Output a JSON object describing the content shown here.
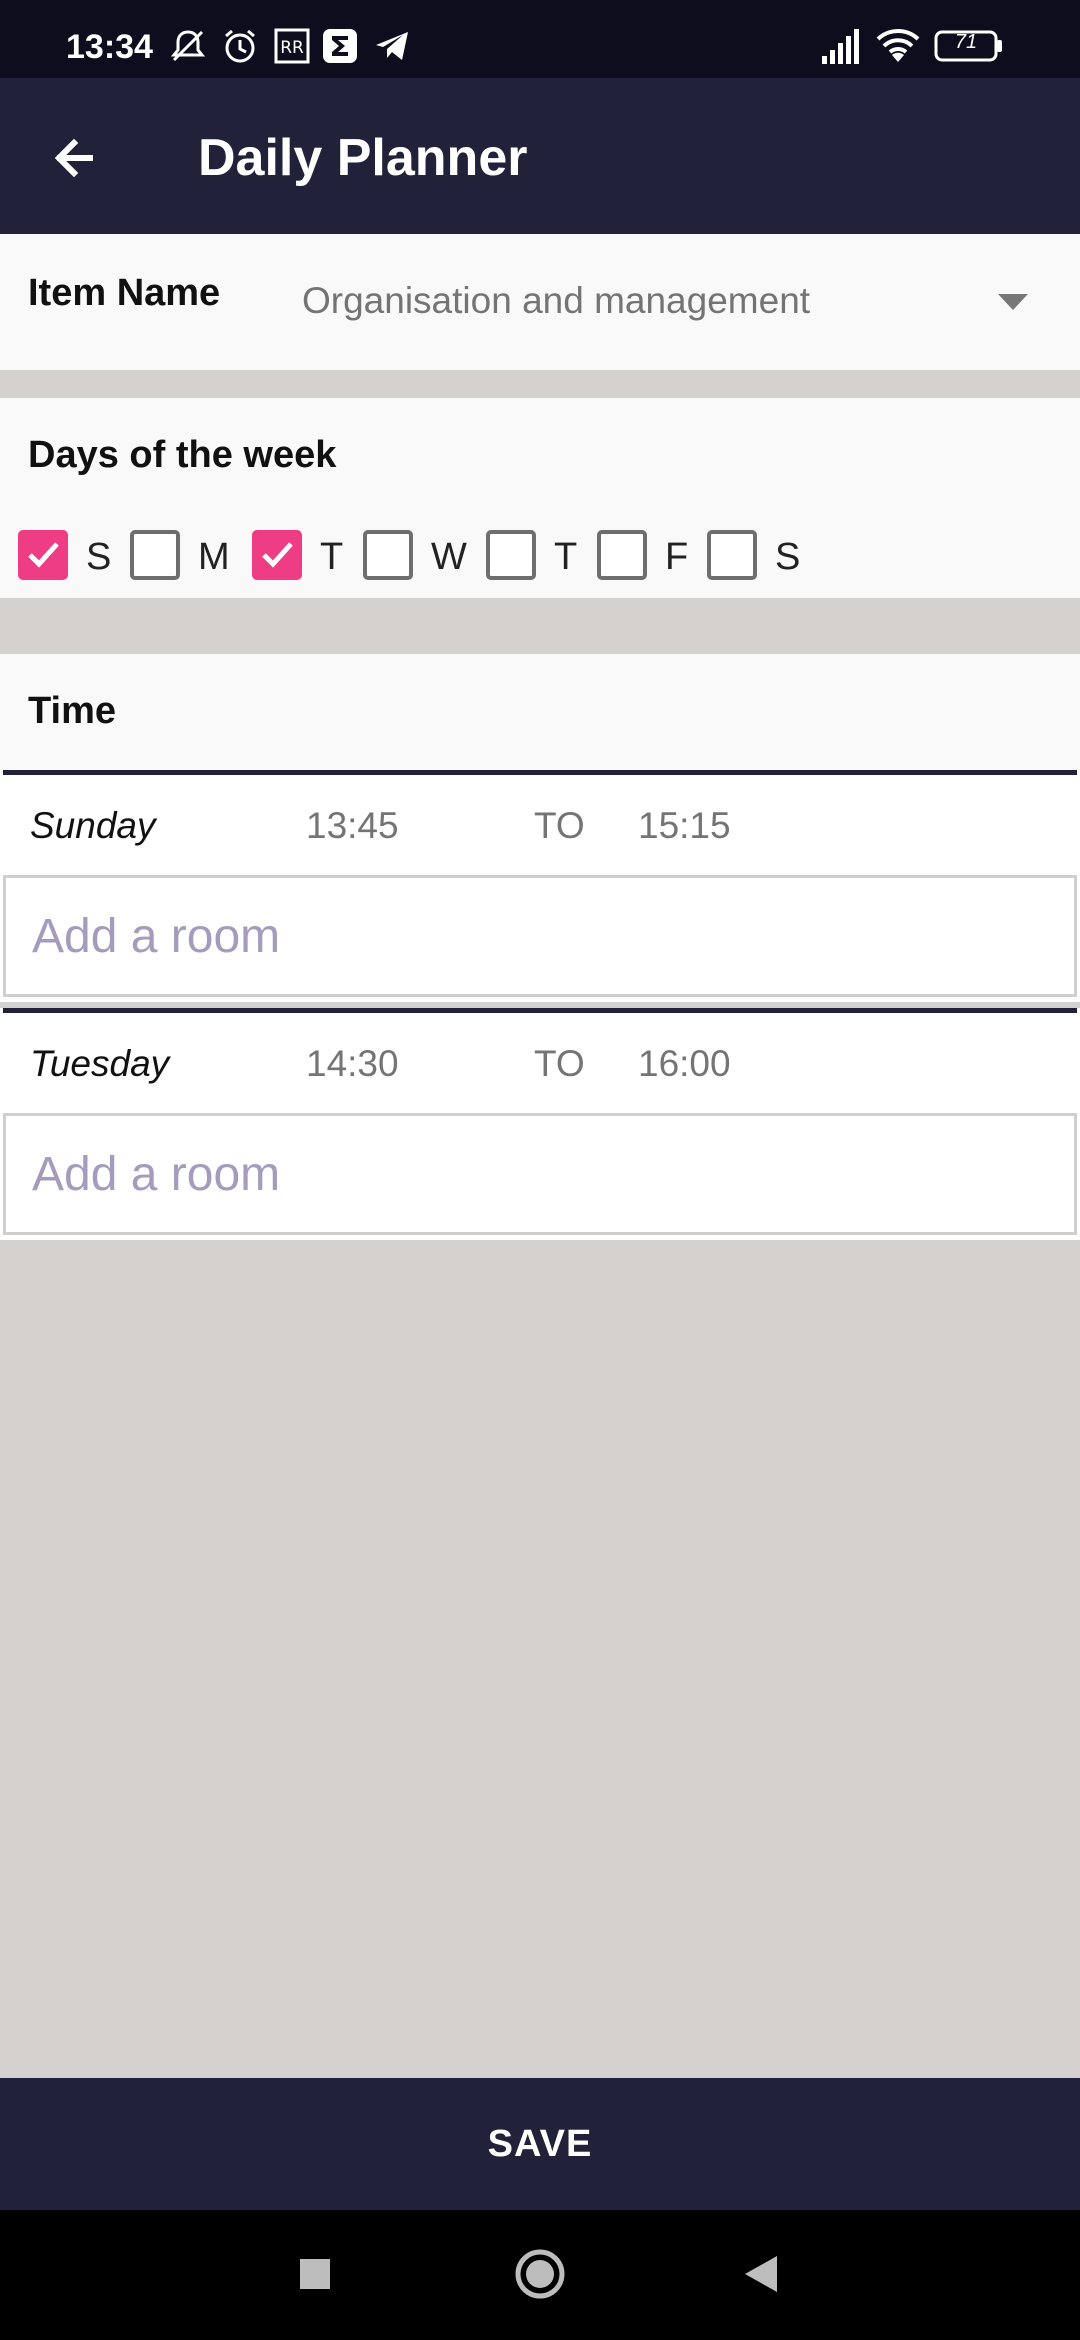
{
  "status_bar": {
    "time": "13:34",
    "battery": "71",
    "icons_left": [
      "mute-alarm-icon",
      "alarm-icon",
      "rr-icon",
      "sigma-icon",
      "telegram-icon"
    ],
    "icons_right": [
      "signal-icon",
      "wifi-icon",
      "battery-icon"
    ]
  },
  "app_bar": {
    "title": "Daily Planner",
    "back_icon": "arrow-left-icon"
  },
  "item_name": {
    "label": "Item Name",
    "value": "Organisation and management"
  },
  "days": {
    "title": "Days of the week",
    "items": [
      {
        "label": "S",
        "checked": true
      },
      {
        "label": "M",
        "checked": false
      },
      {
        "label": "T",
        "checked": true
      },
      {
        "label": "W",
        "checked": false
      },
      {
        "label": "T",
        "checked": false
      },
      {
        "label": "F",
        "checked": false
      },
      {
        "label": "S",
        "checked": false
      }
    ]
  },
  "time": {
    "title": "Time",
    "entries": [
      {
        "day": "Sunday",
        "start": "13:45",
        "to": "TO",
        "end": "15:15",
        "room_placeholder": "Add a room"
      },
      {
        "day": "Tuesday",
        "start": "14:30",
        "to": "TO",
        "end": "16:00",
        "room_placeholder": "Add a room"
      }
    ]
  },
  "save": {
    "label": "SAVE"
  },
  "colors": {
    "primary_dark": "#22213a",
    "accent": "#ee3d84",
    "background": "#d5d1cf",
    "placeholder": "#a59bbd"
  }
}
